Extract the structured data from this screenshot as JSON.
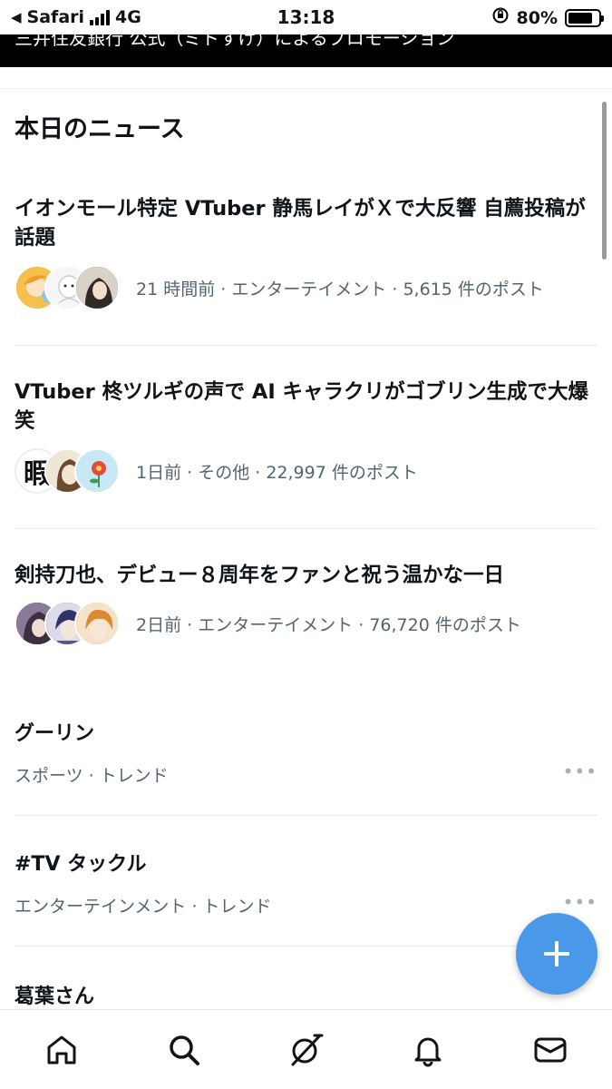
{
  "status_bar": {
    "back_app": "Safari",
    "network": "4G",
    "time": "13:18",
    "battery_pct": "80%",
    "battery_level": 0.8
  },
  "promo": {
    "text": "三井住友銀行 公式（ミドすけ）によるプロモーション"
  },
  "section_title": "本日のニュース",
  "news": [
    {
      "title": "イオンモール特定 VTuber 静馬レイがＸで大反響 自薦投稿が話題",
      "meta": "21 時間前 · エンターテイメント · 5,615 件のポスト",
      "avatar_colors": [
        "#f2b23a",
        "#e8eef2",
        "#3a3430"
      ]
    },
    {
      "title": "VTuber 柊ツルギの声で AI キャラクリがゴブリン生成で大爆笑",
      "meta": "1日前 · その他 · 22,997 件のポスト",
      "avatar_glyph": "暇",
      "avatar_colors": [
        "#ffffff",
        "#e8dcc8",
        "#bfe3f2"
      ]
    },
    {
      "title": "剣持刀也、デビュー８周年をファンと祝う温かな一日",
      "meta": "2日前 · エンターテイメント · 76,720 件のポスト",
      "avatar_colors": [
        "#5a4a6a",
        "#3b3f6e",
        "#e8a04a"
      ]
    }
  ],
  "trends": [
    {
      "title": "グーリン",
      "subtitle": "スポーツ · トレンド",
      "more": "•••"
    },
    {
      "title": "#TV タックル",
      "subtitle": "エンターテインメント · トレンド",
      "more": "•••"
    },
    {
      "title": "葛葉さん"
    }
  ],
  "fab_icon": "plus-icon",
  "nav": [
    "home-icon",
    "search-icon",
    "grok-icon",
    "notifications-icon",
    "messages-icon"
  ],
  "colors": {
    "accent": "#4a99e9",
    "secondary_text": "#536471"
  }
}
